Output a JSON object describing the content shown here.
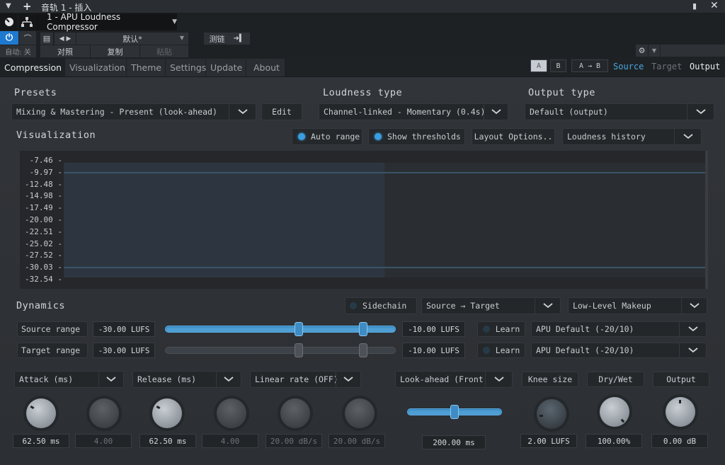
{
  "host": {
    "title": "音轨 1 - 插入",
    "plugin_name": "1 - APU Loudness Compressor",
    "preset_name": "默认*",
    "auto_label": "自动: 关",
    "compare_label": "对照",
    "copy_label": "复制",
    "paste_label": "粘贴",
    "sidechain_label": "测链"
  },
  "tabs": [
    {
      "label": "Compression",
      "active": true
    },
    {
      "label": "Visualization"
    },
    {
      "label": "Theme"
    },
    {
      "label": "Settings"
    },
    {
      "label": "Update"
    },
    {
      "label": "About"
    }
  ],
  "ab": {
    "a": "A",
    "b": "B",
    "a_to_b": "A → B",
    "selected": "A"
  },
  "view_modes": {
    "source": "Source",
    "target": "Target",
    "output": "Output",
    "colors": {
      "source": "#4aa6df",
      "target": "#6d7378",
      "output": "#e8eaec"
    }
  },
  "presets": {
    "label": "Presets",
    "value": "Mixing & Mastering - Present (look-ahead)",
    "edit": "Edit"
  },
  "loudness_type": {
    "label": "Loudness type",
    "value": "Channel-linked - Momentary (0.4s)"
  },
  "output_type": {
    "label": "Output type",
    "value": "Default (output)"
  },
  "visualization": {
    "label": "Visualization",
    "auto_range": "Auto range",
    "show_thresholds": "Show thresholds",
    "layout_options": "Layout Options..",
    "mode": "Loudness history",
    "ticks": [
      "-7.46",
      "-9.97",
      "-12.48",
      "-14.98",
      "-17.49",
      "-20.00",
      "-22.51",
      "-25.02",
      "-27.52",
      "-30.03",
      "-32.54"
    ],
    "threshold_high": -10.0,
    "threshold_low": -30.0,
    "history_fill_fraction": 0.5
  },
  "dynamics": {
    "label": "Dynamics",
    "sidechain": "Sidechain",
    "routing": "Source → Target",
    "makeup": "Low-Level Makeup",
    "source_range": {
      "label": "Source range",
      "low": "-30.00 LUFS",
      "high": "-10.00 LUFS",
      "learn": "Learn",
      "preset": "APU Default (-20/10)",
      "low_pos": 0.58,
      "high_pos": 0.86
    },
    "target_range": {
      "label": "Target range",
      "low": "-30.00 LUFS",
      "high": "-10.00 LUFS",
      "learn": "Learn",
      "preset": "APU Default (-20/10)",
      "low_pos": 0.58,
      "high_pos": 0.86
    }
  },
  "controls": {
    "attack": {
      "label": "Attack (ms)",
      "value": "62.50 ms",
      "secondary": "4.00"
    },
    "release": {
      "label": "Release (ms)",
      "value": "62.50 ms",
      "secondary": "4.00"
    },
    "linear_rate": {
      "label": "Linear rate (OFF)",
      "value1": "20.00 dB/s",
      "value2": "20.00 dB/s"
    },
    "lookahead": {
      "label": "Look-ahead (Front",
      "value": "200.00 ms",
      "position": 0.5
    },
    "knee": {
      "label": "Knee size",
      "value": "2.00 LUFS"
    },
    "drywet": {
      "label": "Dry/Wet",
      "value": "100.00%"
    },
    "output": {
      "label": "Output",
      "value": "0.00 dB"
    }
  }
}
